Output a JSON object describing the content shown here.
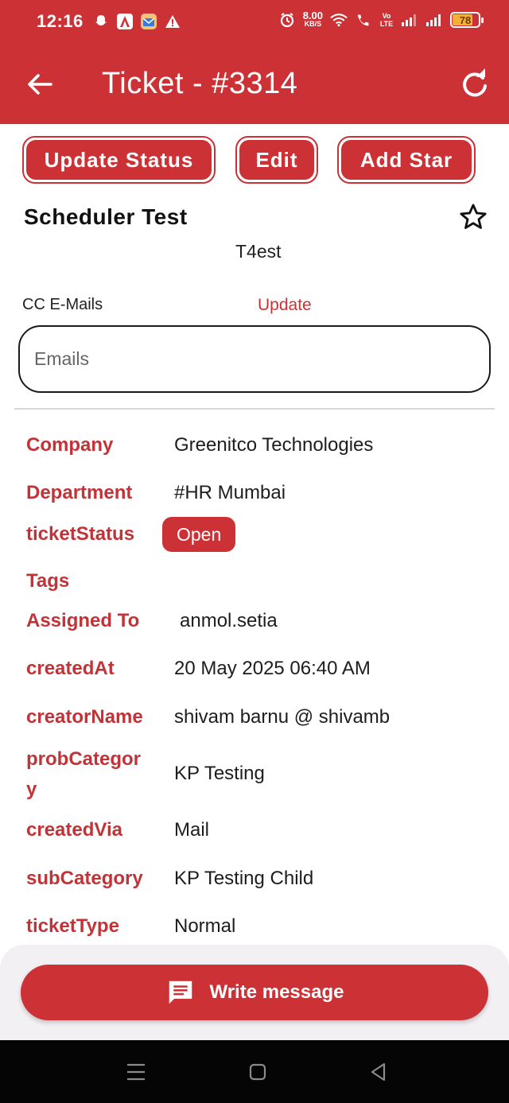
{
  "status_bar": {
    "time": "12:16",
    "net_speed_value": "8.00",
    "net_speed_unit": "KB/S",
    "volte_label": "Vo LTE",
    "battery_percent": "78",
    "battery_level": 0.78
  },
  "header": {
    "title": "Ticket - #3314"
  },
  "actions": {
    "update_status": "Update Status",
    "edit": "Edit",
    "add_star": "Add Star"
  },
  "ticket": {
    "subject": "Scheduler Test",
    "description": "T4est"
  },
  "cc": {
    "label": "CC E-Mails",
    "update_label": "Update",
    "placeholder": "Emails",
    "value": ""
  },
  "details": {
    "company_label": "Company",
    "company_value": "Greenitco Technologies",
    "department_label": "Department",
    "department_value": "#HR Mumbai",
    "status_label": "ticketStatus",
    "status_value": "Open",
    "tags_label": "Tags",
    "assigned_label": "Assigned To",
    "assigned_value": "anmol.setia",
    "created_at_label": "createdAt",
    "created_at_value": "20 May 2025 06:40 AM",
    "creator_label": "creatorName",
    "creator_value": "shivam barnu @ shivamb",
    "prob_category_label_1": "probCategor",
    "prob_category_label_2": "y",
    "prob_category_value": "KP Testing",
    "created_via_label": "createdVia",
    "created_via_value": "Mail",
    "sub_category_label": "subCategory",
    "sub_category_value": "KP Testing Child",
    "ticket_type_label": "ticketType",
    "ticket_type_value": "Normal"
  },
  "composer": {
    "write_message_label": "Write message"
  },
  "colors": {
    "accent": "#cc3135",
    "label_red": "#c23338",
    "battery": "#f2b134"
  }
}
